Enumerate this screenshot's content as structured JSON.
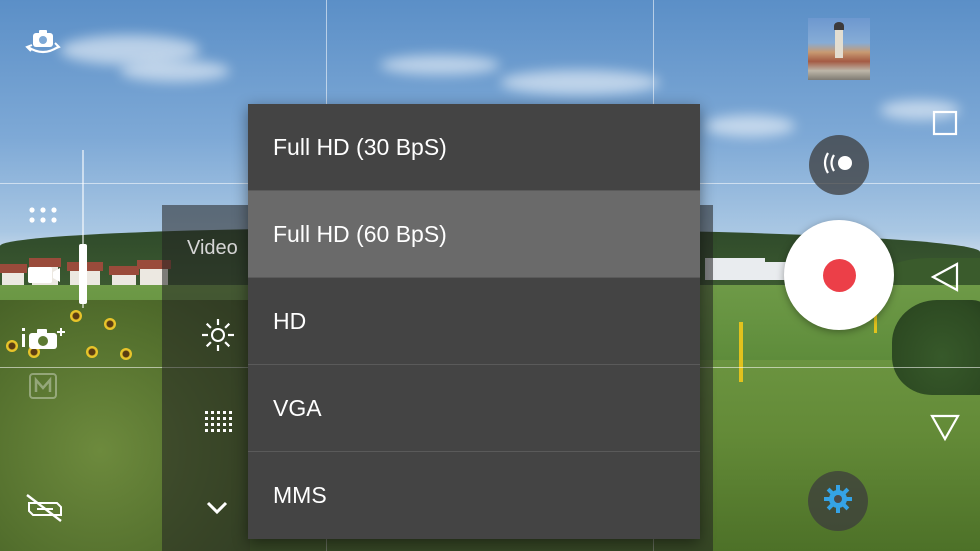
{
  "camera": {
    "mode_label": "Video",
    "resolution_menu": {
      "selected_index": 1,
      "options": [
        "Full HD (30 BpS)",
        "Full HD (60 BpS)",
        "HD",
        "VGA",
        "MMS"
      ]
    },
    "icons": {
      "switch_camera": "switch-camera-icon",
      "mode_grid": "mode-grid-icon",
      "video_mode": "video-camera-icon",
      "photo_info": "photo-info-icon",
      "flash_off": "flash-off-icon",
      "brightness": "brightness-icon",
      "grid_overlay": "grid-overlay-icon",
      "collapse": "chevron-down-icon",
      "broadcast": "broadcast-icon",
      "settings": "gear-icon"
    },
    "colors": {
      "record_dot": "#ec3f48",
      "settings_icon": "#35a3e6",
      "menu_background": "#444444",
      "menu_selected": "#6a6a6a"
    }
  },
  "nav_bar": {
    "icons": [
      "recents-square-icon",
      "back-triangle-icon",
      "home-down-triangle-icon"
    ]
  }
}
